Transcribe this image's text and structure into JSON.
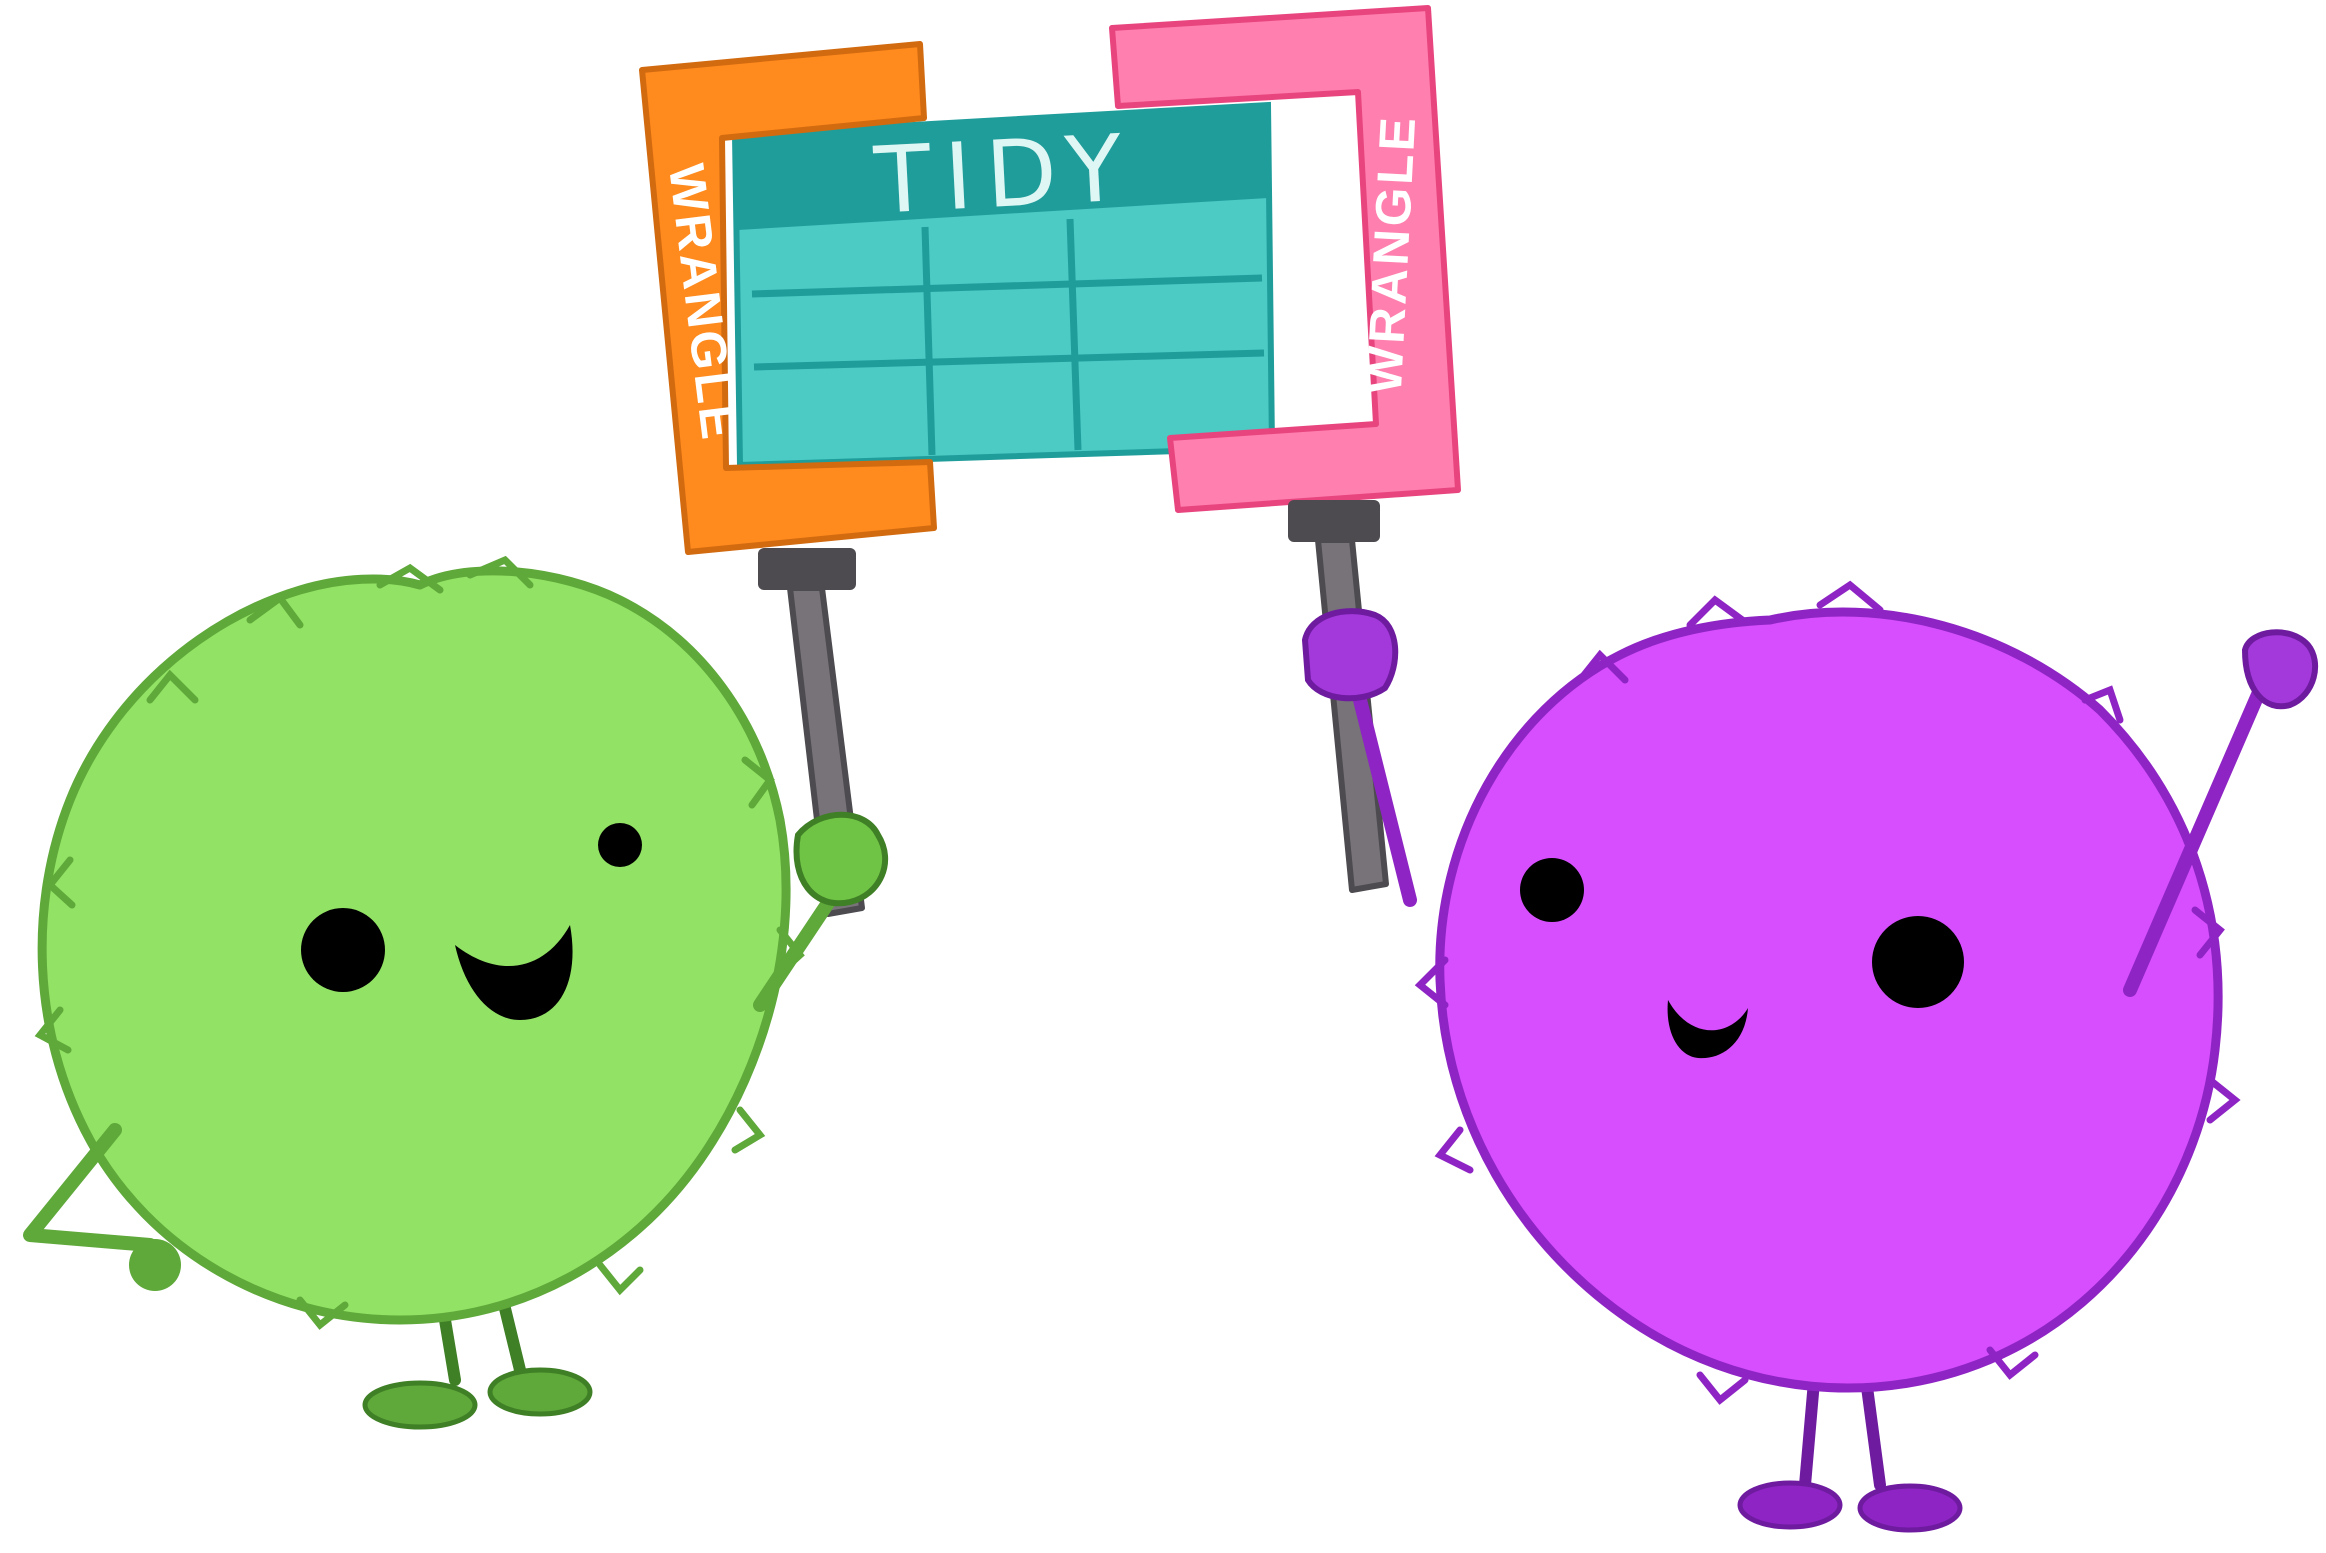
{
  "title": "TIDY",
  "left_clamp_label": "WRANGLE",
  "right_clamp_label": "WRANGLE",
  "icons": {
    "green_monster": "green-fuzzy-monster",
    "purple_monster": "purple-fuzzy-monster",
    "left_clamp": "orange-c-clamp",
    "right_clamp": "pink-c-clamp",
    "table": "tidy-data-table"
  },
  "colors": {
    "green_fill": "#92E265",
    "green_stroke": "#5FA83A",
    "purple_fill": "#D64EFD",
    "purple_stroke": "#8E24C4",
    "orange_clamp": "#FF8A1E",
    "orange_stroke": "#D26A10",
    "pink_clamp": "#FF80AE",
    "pink_stroke": "#E8457F",
    "table_header": "#1F9D9B",
    "table_cells": "#4CCAC4",
    "table_grid": "#1F9D9B",
    "title_text": "#DFF7F4",
    "handle": "#777378",
    "handle_dark": "#4D4B4F"
  }
}
